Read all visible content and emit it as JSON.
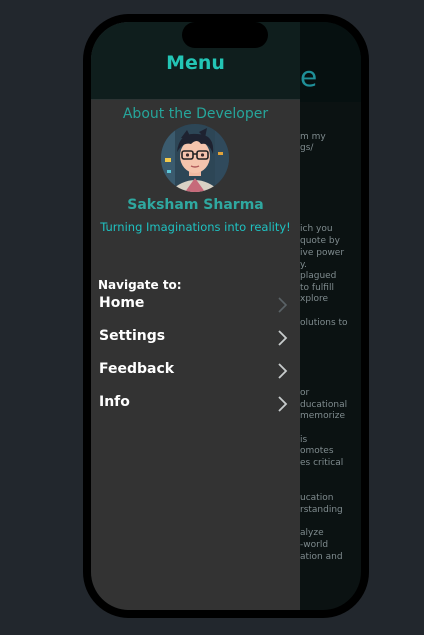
{
  "background_page": {
    "title": "e",
    "lines": [
      "m my",
      "gs/",
      "ich you",
      "quote by",
      "ive power",
      "y.",
      "plagued",
      "to fulfill",
      "xplore",
      "olutions to",
      "or",
      "ducational",
      "memorize",
      "is",
      "omotes",
      "es critical",
      "ucation",
      "rstanding",
      "alyze",
      "-world",
      "ation and"
    ]
  },
  "drawer": {
    "title": "Menu",
    "about_heading": "About the Developer",
    "developer_name": "Saksham Sharma",
    "tagline": "Turning Imaginations into reality!",
    "nav_label": "Navigate to:",
    "items": [
      {
        "label": "Home"
      },
      {
        "label": "Settings"
      },
      {
        "label": "Feedback"
      },
      {
        "label": "Info"
      }
    ]
  },
  "colors": {
    "accent": "#23c5b5",
    "drawer_bg": "#333333",
    "screen_bg": "#22272d"
  }
}
